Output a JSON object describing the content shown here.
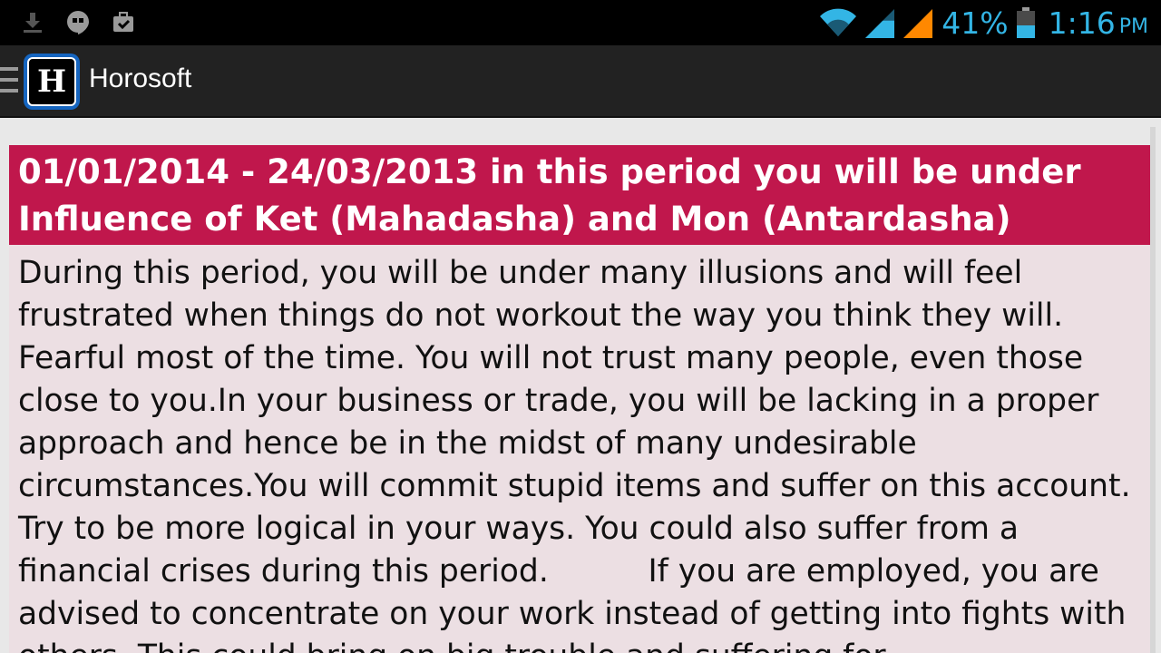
{
  "status_bar": {
    "battery_percent": "41%",
    "time": "1:16",
    "am_pm": "PM",
    "accent_color": "#33b5e5",
    "left_icons": [
      "download-icon",
      "hangouts-icon",
      "briefcase-icon"
    ],
    "right_icons": [
      "wifi-icon",
      "signal-icon",
      "signal-roaming-icon",
      "battery-icon"
    ]
  },
  "action_bar": {
    "logo_letter": "H",
    "title": "Horosoft"
  },
  "content": {
    "header": "01/01/2014 - 24/03/2013  in this period you will be under Influence of Ket  (Mahadasha) and Mon (Antardasha)",
    "body": "During this period, you will be under many illusions and will feel frustrated when things do not workout the way you think they will. Fearful most of the time. You will not trust many people, even those close to you.In your business or trade, you will be lacking in a proper approach and hence be in the midst of many undesirable circumstances.You will commit stupid items and suffer on this account. Try to be more logical in your ways. You could also suffer from a financial crises during this period.          If you are employed, you are advised to concentrate on your work instead of getting into fights with others. This could bring on big trouble and suffering for",
    "header_color": "#c0174c",
    "body_bg_color": "#ecdfe3"
  }
}
